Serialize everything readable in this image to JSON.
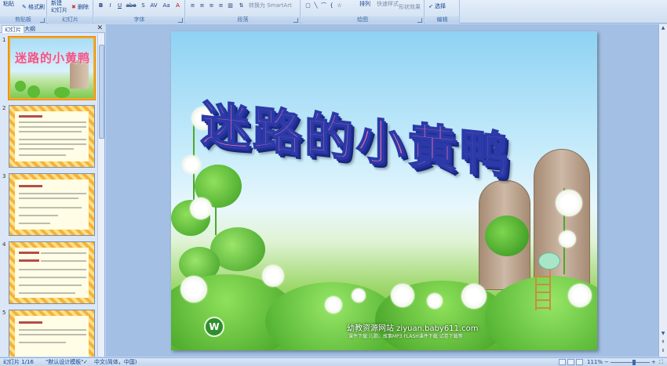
{
  "ribbon": {
    "clipboard": {
      "paste": "粘贴",
      "format_painter": "格式刷",
      "label": "剪贴板"
    },
    "slides": {
      "new_slide_line1": "新建",
      "new_slide_line2": "幻灯片",
      "delete": "删除",
      "label": "幻灯片"
    },
    "font": {
      "label": "字体",
      "buttons": [
        "B",
        "I",
        "U",
        "abe",
        "S",
        "AV",
        "Aa",
        "A"
      ]
    },
    "paragraph": {
      "label": "段落",
      "smartart": "转换为 SmartArt"
    },
    "drawing": {
      "label": "绘图",
      "arrange": "排列",
      "quick_styles": "快速样式",
      "shape_effects": "形状效果"
    },
    "editing": {
      "label": "编辑",
      "select": "选择"
    }
  },
  "slide_pane": {
    "tabs": [
      "幻灯片",
      "大纲"
    ],
    "close": "✕",
    "thumbnails": [
      {
        "num": "1",
        "title": "迷路的小黄鸭",
        "selected": true
      },
      {
        "num": "2"
      },
      {
        "num": "3"
      },
      {
        "num": "4"
      },
      {
        "num": "5"
      }
    ]
  },
  "slide": {
    "title": "迷路的小黄鸭",
    "watermark": "幼教资源网站  ziyuan.baby611.com",
    "watermark_sub": "课件下载    儿歌、故事MP3    FLASH课件下载    试卷下载等",
    "logo": "W"
  },
  "status_bar": {
    "slide_count": "幻灯片 1/16",
    "theme": "\"默认设计模板\"",
    "language": "中文(简体，中国)",
    "zoom": "111%"
  }
}
